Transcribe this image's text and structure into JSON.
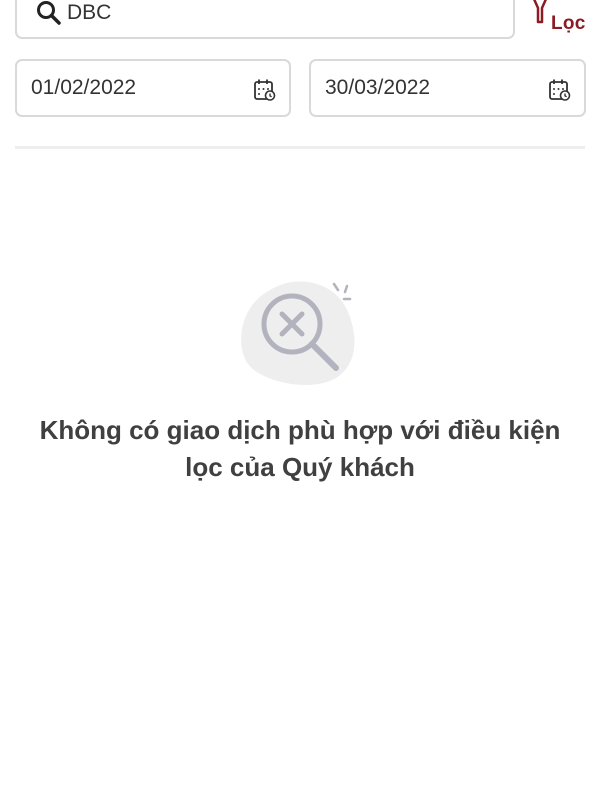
{
  "search": {
    "value": "DBC",
    "icon": "search-icon"
  },
  "filter": {
    "label": "Lọc",
    "icon": "filter-icon",
    "accent_color": "#8b1c24"
  },
  "date_range": {
    "from": "01/02/2022",
    "to": "30/03/2022",
    "icon": "calendar-icon"
  },
  "empty_state": {
    "icon": "no-results-magnifier-icon",
    "message_line1": "Không có giao dịch phù hợp với điều kiện",
    "message_line2": "lọc của Quý khách"
  }
}
